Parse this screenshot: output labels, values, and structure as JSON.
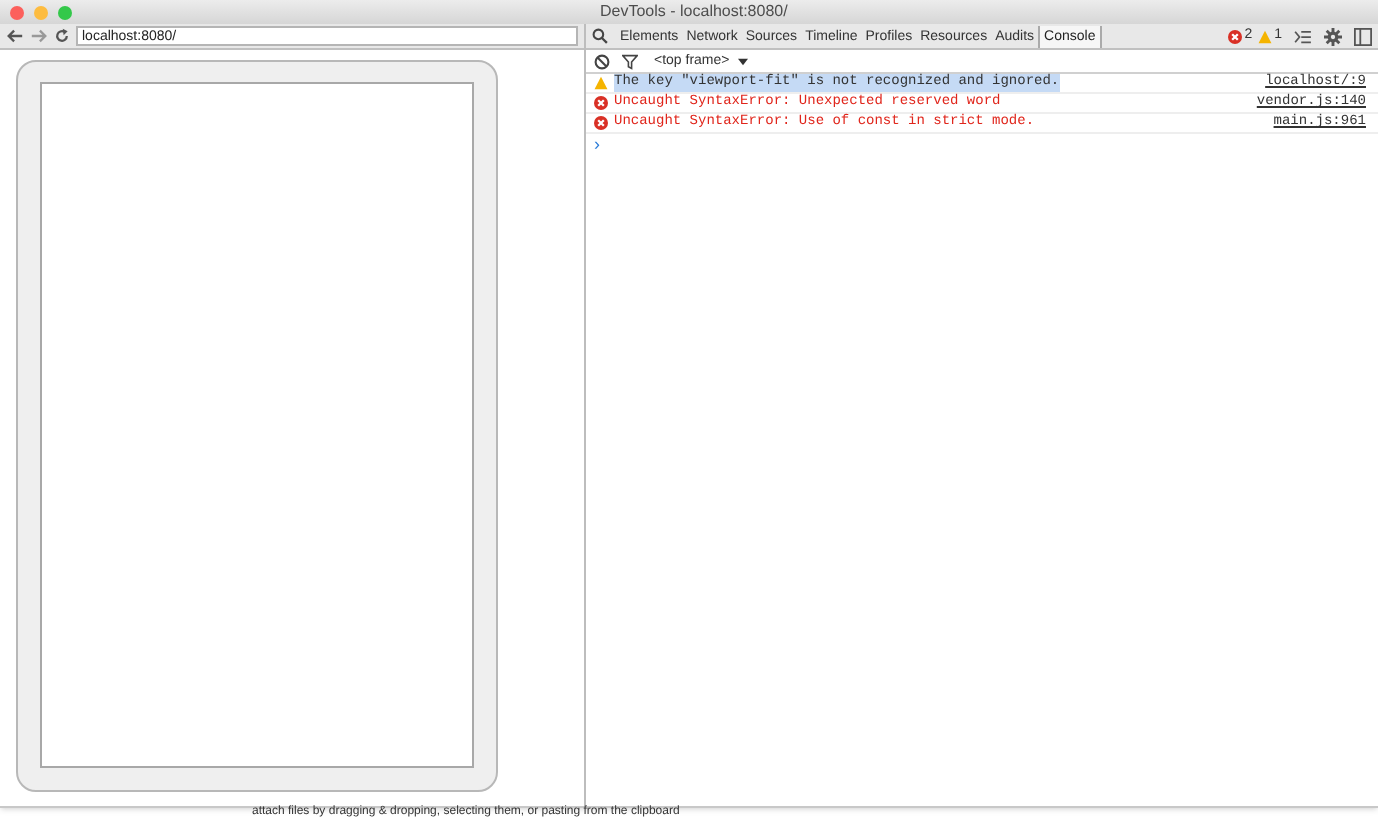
{
  "window": {
    "title": "DevTools - localhost:8080/"
  },
  "browser": {
    "url": "localhost:8080/"
  },
  "devtools": {
    "tabs": [
      {
        "label": "Elements",
        "selected": false
      },
      {
        "label": "Network",
        "selected": false
      },
      {
        "label": "Sources",
        "selected": false
      },
      {
        "label": "Timeline",
        "selected": false
      },
      {
        "label": "Profiles",
        "selected": false
      },
      {
        "label": "Resources",
        "selected": false
      },
      {
        "label": "Audits",
        "selected": false
      },
      {
        "label": "Console",
        "selected": true
      }
    ],
    "error_count": "2",
    "warning_count": "1"
  },
  "console": {
    "frame": "<top frame>",
    "messages": [
      {
        "kind": "warning",
        "text": "The key \"viewport-fit\" is not recognized and ignored.",
        "source": "localhost/:9",
        "selected": true
      },
      {
        "kind": "error",
        "text": "Uncaught SyntaxError: Unexpected reserved word",
        "source": "vendor.js:140",
        "selected": false
      },
      {
        "kind": "error",
        "text": "Uncaught SyntaxError: Use of const in strict mode.",
        "source": "main.js:961",
        "selected": false
      }
    ],
    "prompt": "›"
  },
  "background_page": {
    "text": "attach files by dragging & dropping, selecting them, or pasting from the clipboard"
  }
}
